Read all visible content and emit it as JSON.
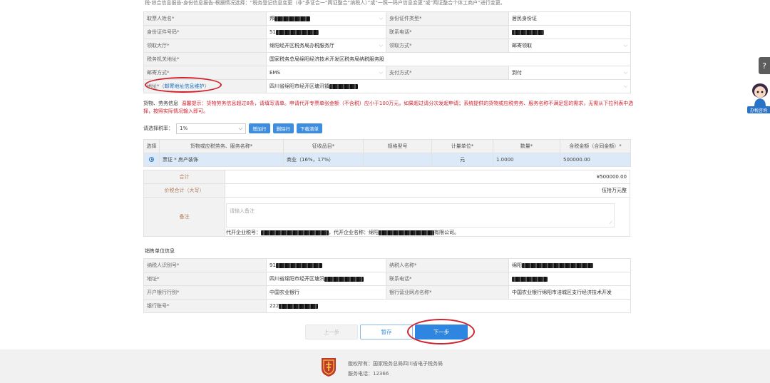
{
  "top_note": "税-综合信息报告-身份信息报告-根据情况选择：“税务登记信息变更（非“多证合一”两证整合“纳税人）”或“一照一码户信息变更”或“两证整合个体工商户”进行变更。",
  "form": {
    "payer_name_label": "取票人姓名*",
    "payer_name_value": "邦",
    "id_type_label": "身份证件类型*",
    "id_type_value": "居民身份证",
    "id_number_label": "身份证件号码*",
    "id_number_value": "51",
    "phone_label": "联系电话*",
    "hall_label": "领取大厅*",
    "hall_value": "绵阳经开区税务局办税服务厅",
    "receive_method_label": "领取方式*",
    "receive_method_value": "邮寄领取",
    "tax_office_addr_label": "税务机关地址*",
    "tax_office_addr_value": "国家税务总局绵阳经济技术开发区税务局纳税服务股",
    "mail_method_label": "邮寄方式*",
    "mail_method_value": "EMS",
    "pay_method_label": "支付方式*",
    "pay_method_value": "到付",
    "address_label_prefix": "地址*（",
    "address_link": "邮寄地址信息维护",
    "address_label_suffix": "）",
    "address_value": "四川省绵阳市经开区塘汛镇"
  },
  "notice": {
    "heading": "货物、劳务信息",
    "text": "温馨提示：货物劳务信息超过8条，请填写清单。申请代开专票单张金额（不含税）应小于100万元，如果超过请分次发起申请；系统提供的货物或应税劳务、服务名称不满足您的需求，无需从下拉列表中选择，按照实际情况输入即可。"
  },
  "tax_rate": {
    "label": "请选择税率：",
    "value": "1%",
    "buttons": [
      "增加行",
      "删除行",
      "下载清单"
    ]
  },
  "goods_table": {
    "headers": [
      "选择",
      "货物或应税劳务、服务名称*",
      "征收品目*",
      "规格型号",
      "计量单位*",
      "数量*",
      "含税金额（合同金额）*"
    ],
    "rows": [
      {
        "name": "票证 * 房产装饰",
        "item": "商业（16%，17%）",
        "spec": "",
        "unit": "元",
        "qty": "1.0000",
        "amount": "500000.00"
      }
    ]
  },
  "summary": {
    "total_label": "合计",
    "total_value": "¥500000.00",
    "total_upper_label": "价税合计（大写）",
    "total_upper_value": "伍拾万元整",
    "remark_label": "备注",
    "remark_placeholder": "请输入备注",
    "agent_prefix": "代开企业税号：",
    "agent_mid": "，代开企业名称：绵阳",
    "agent_suffix": "有限公司。"
  },
  "seller": {
    "title": "销售单位信息",
    "taxpayer_id_label": "纳税人识别号*",
    "taxpayer_id_value": "91",
    "taxpayer_name_label": "纳税人名称*",
    "taxpayer_name_value": "绵阳",
    "address_label": "地址*",
    "address_value": "四川省绵阳市经开区塘汛",
    "phone_label": "联系电话*",
    "bank_label": "开户银行行别*",
    "bank_value": "中国农业银行",
    "branch_label": "银行营业网点名称*",
    "branch_value": "中国农业银行绵阳市涪城区支行经济技术开发",
    "account_label": "银行账号*",
    "account_value": "222"
  },
  "buttons": {
    "prev": "上一步",
    "save": "暂存",
    "next": "下一步"
  },
  "footer": {
    "copyright": "版权所有：国家税务总局四川省电子税务局",
    "service": "服务电话：12366"
  },
  "side": {
    "label": "办税咨询"
  },
  "colors": {
    "accent": "#2a74c8",
    "highlight": "#d2222c",
    "label_bg": "#f2f2f2"
  }
}
